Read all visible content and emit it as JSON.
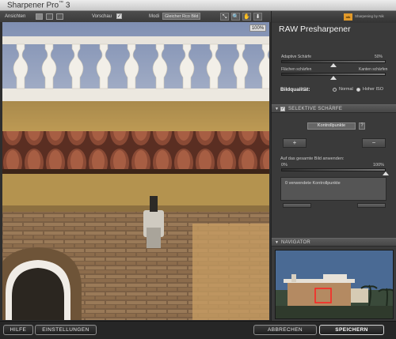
{
  "window": {
    "title": "Sharpener Pro",
    "title_tm": "™",
    "title_version": "3"
  },
  "toolbar": {
    "view_label": "Ansichten",
    "preview_label": "Vorschau",
    "preview_checked": "✓",
    "mode_label": "Modi",
    "mode_value": "Gleicher Rco Bild",
    "tools": [
      "⤡",
      "🔍",
      "✋",
      "⬇"
    ]
  },
  "preview": {
    "zoom": "100%"
  },
  "panel": {
    "brand_logo": "nik",
    "brand_text": "Sharpening by Nik",
    "title": "RAW Presharpener",
    "adaptive_label": "Adaptive Schärfe",
    "adaptive_value": "50%",
    "adaptive_fraction": 0.5,
    "surfaces_label": "Flächen schärfen",
    "edges_label": "Kanten schärfen",
    "balance_fraction": 0.5,
    "quality_label": "Bildqualität:",
    "quality_options": [
      "Normal",
      "Hoher ISO"
    ],
    "quality_selected": 1
  },
  "selective": {
    "header": "SELEKTIVE SCHÄRFE",
    "checked": "✓",
    "dropdown": "Kontrollpunkte",
    "help": "?",
    "plus": "+",
    "minus": "−",
    "apply_label": "Auf das gesamte Bild anwenden:",
    "min_pct": "0%",
    "max_pct": "100%",
    "apply_fraction": 1.0,
    "count_text": "0 verwendete Kontrollpunkte"
  },
  "navigator": {
    "header": "NAVIGATOR"
  },
  "footer": {
    "help": "HILFE",
    "settings": "EINSTELLUNGEN",
    "cancel": "ABBRECHEN",
    "save": "SPEICHERN"
  }
}
